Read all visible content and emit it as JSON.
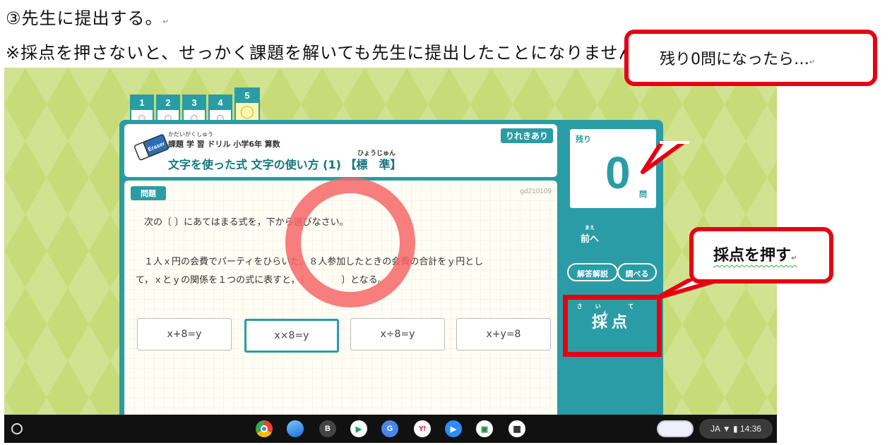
{
  "doc": {
    "line1": "③先生に提出する。",
    "line2": "※採点を押さないと、せっかく課題を解いても先生に提出したことになりません。",
    "pilcrow": "↵"
  },
  "tabs": [
    {
      "num": "1",
      "mark": "○"
    },
    {
      "num": "2",
      "mark": "○"
    },
    {
      "num": "3",
      "mark": "○"
    },
    {
      "num": "4",
      "mark": "○"
    },
    {
      "num": "5",
      "mark": "◯"
    }
  ],
  "header": {
    "eraser_text": "Eraser",
    "kadai_ruby": "かだいがくしゅう",
    "kadai_title": "課題 学 習 ドリル 小学6年 算数",
    "unit_ruby": "ひょうじゅん",
    "unit_title": "文字を使った式 文字の使い方 (1) 【標　準】",
    "history_badge": "りれきあり"
  },
  "question": {
    "label": "問題",
    "id": "gd210109",
    "line1": "次の〔 〕にあてはまる式を，下から選びなさい。",
    "line2": "１人ｘ円の会費でパーティをひらいた。８人参加したときの会費の合計をｙ円とし",
    "line3": "て，ｘとｙの関係を１つの式に表すと，〔　　　　〕となる。",
    "choices": [
      "x+8=y",
      "x×8=y",
      "x÷8=y",
      "x+y=8"
    ],
    "selected_index": 1
  },
  "side": {
    "remain_label": "残り",
    "remain_count": "0",
    "remain_unit": "問",
    "prev_ruby": "まえ",
    "prev_label": "前へ",
    "kaisetsu_label": "解答解説",
    "shiraberu_label": "調べる",
    "saiten_ruby": "さい てん",
    "saiten_label": "採点"
  },
  "callouts": {
    "remaining": "残り0問になったら…",
    "press": "採点を押す"
  },
  "taskbar": {
    "ime": "JA",
    "time": "14:36",
    "apps": [
      "chrome-icon",
      "wave-icon",
      "b-icon",
      "play-icon",
      "translate-icon",
      "yahoo-icon",
      "meet-icon",
      "classroom-icon",
      "qr-icon"
    ]
  },
  "colors": {
    "accent": "#2a9ca5",
    "highlight_red": "#e60012",
    "background_green": "#c7dc78"
  }
}
